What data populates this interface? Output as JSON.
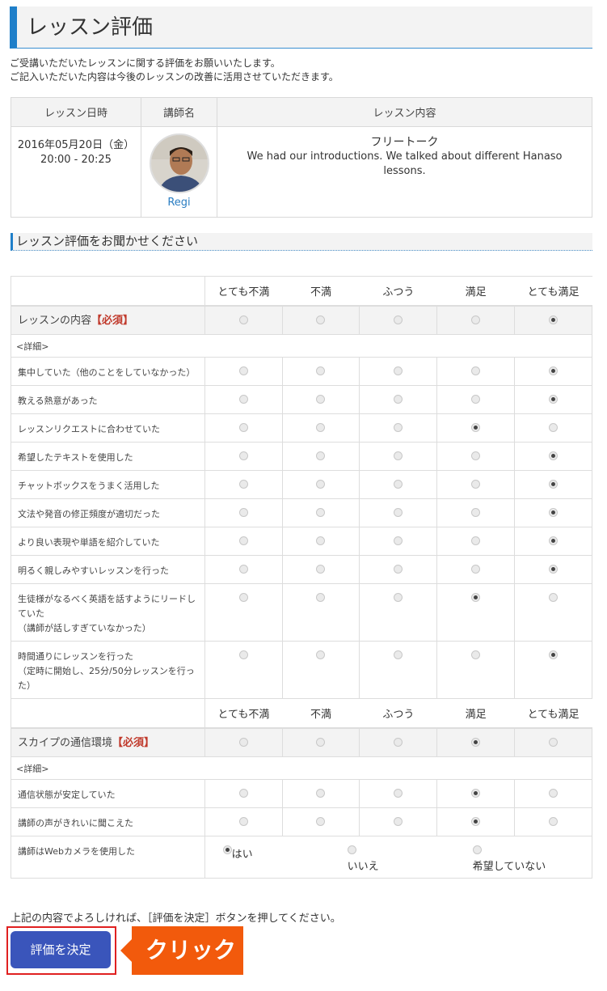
{
  "page": {
    "title": "レッスン評価",
    "intro_line1": "ご受講いただいたレッスンに関する評価をお願いいたします。",
    "intro_line2": "ご記入いただいた内容は今後のレッスンの改善に活用させていただきます。"
  },
  "lesson": {
    "headers": [
      "レッスン日時",
      "講師名",
      "レッスン内容"
    ],
    "date": "2016年05月20日（金）",
    "time": "20:00 - 20:25",
    "teacher": "Regi",
    "content_title": "フリートーク",
    "content_text": "We had our introductions. We talked about different Hanaso lessons."
  },
  "section_title": "レッスン評価をお聞かせください",
  "scale": [
    "とても不満",
    "不満",
    "ふつう",
    "満足",
    "とても満足"
  ],
  "lesson_rating": {
    "label": "レッスンの内容",
    "required": "【必須】",
    "selected": 4,
    "details_label": "<詳細>",
    "items": [
      {
        "label": "集中していた（他のことをしていなかった）",
        "selected": 4
      },
      {
        "label": "教える熱意があった",
        "selected": 4
      },
      {
        "label": "レッスンリクエストに合わせていた",
        "selected": 3
      },
      {
        "label": "希望したテキストを使用した",
        "selected": 4
      },
      {
        "label": "チャットボックスをうまく活用した",
        "selected": 4
      },
      {
        "label": "文法や発音の修正頻度が適切だった",
        "selected": 4
      },
      {
        "label": "より良い表現や単語を紹介していた",
        "selected": 4
      },
      {
        "label": "明るく親しみやすいレッスンを行った",
        "selected": 4
      },
      {
        "label": "生徒様がなるべく英語を話すようにリードしていた（講師が話しすぎていなかった）",
        "line1": "生徒様がなるべく英語を話すようにリードし",
        "line2": "ていた",
        "line3": "（講師が話しすぎていなかった）",
        "selected": 3
      },
      {
        "label": "時間通りにレッスンを行った（定時に開始し、25分/50分レッスンを行った）",
        "line1": "時間通りにレッスンを行った",
        "line2": "（定時に開始し、25分/50分レッスンを行っ",
        "line3": "た）",
        "selected": 4
      }
    ]
  },
  "skype_rating": {
    "label": "スカイプの通信環境",
    "required": "【必須】",
    "selected": 3,
    "details_label": "<詳細>",
    "items": [
      {
        "label": "通信状態が安定していた",
        "selected": 3
      },
      {
        "label": "講師の声がきれいに聞こえた",
        "selected": 3
      }
    ],
    "camera": {
      "label": "講師はWebカメラを使用した",
      "options": [
        "はい",
        "いいえ",
        "希望していない"
      ],
      "selected": 0
    }
  },
  "footer": {
    "confirm_text": "上記の内容でよろしければ、［評価を決定］ボタンを押してください。",
    "submit_label": "評価を決定",
    "click_callout": "クリック"
  },
  "colors": {
    "accent": "#1f7fc9",
    "button": "#3a55bb",
    "callout": "#f25a0c",
    "required": "#c0392b"
  }
}
